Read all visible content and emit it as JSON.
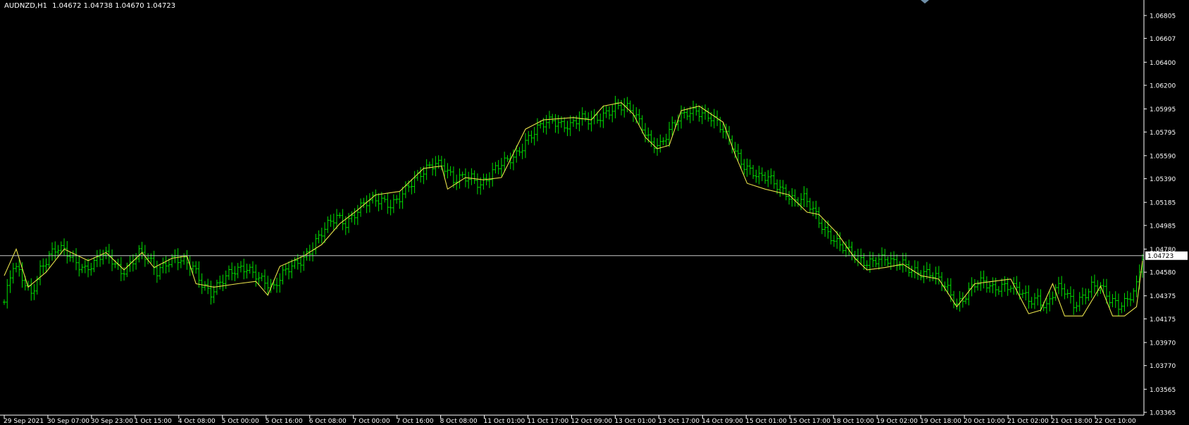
{
  "window": {
    "symbol_timeframe": "AUDNZD,H1",
    "ohlc": "1.04672 1.04738 1.04670 1.04723"
  },
  "colors": {
    "background": "#000000",
    "bars": "#00e000",
    "moving_average": "#e6e04a",
    "price_line": "#c8c8c8",
    "axis": "#ffffff",
    "label_bg": "#ffffff",
    "label_text": "#000000"
  },
  "chart_data": {
    "type": "bar",
    "current_price": "1.04723",
    "y_ticks": [
      "1.06805",
      "1.06607",
      "1.06400",
      "1.06200",
      "1.05995",
      "1.05795",
      "1.05590",
      "1.05390",
      "1.05185",
      "1.04985",
      "1.04780",
      "1.04580",
      "1.04375",
      "1.04175",
      "1.03970",
      "1.03770",
      "1.03565",
      "1.03365"
    ],
    "ylim": [
      1.03365,
      1.06805
    ],
    "x_ticks": [
      "29 Sep 2021",
      "30 Sep 07:00",
      "30 Sep 23:00",
      "1 Oct 15:00",
      "4 Oct 08:00",
      "5 Oct 00:00",
      "5 Oct 16:00",
      "6 Oct 08:00",
      "7 Oct 00:00",
      "7 Oct 16:00",
      "8 Oct 08:00",
      "11 Oct 01:00",
      "11 Oct 17:00",
      "12 Oct 09:00",
      "13 Oct 01:00",
      "13 Oct 17:00",
      "14 Oct 09:00",
      "15 Oct 01:00",
      "15 Oct 17:00",
      "18 Oct 10:00",
      "19 Oct 02:00",
      "19 Oct 18:00",
      "20 Oct 10:00",
      "21 Oct 02:00",
      "21 Oct 18:00",
      "22 Oct 10:00"
    ],
    "price_path": [
      [
        0,
        1.0432
      ],
      [
        3,
        1.0462
      ],
      [
        6,
        1.0452
      ],
      [
        9,
        1.044
      ],
      [
        12,
        1.0462
      ],
      [
        15,
        1.0472
      ],
      [
        18,
        1.0477
      ],
      [
        21,
        1.0474
      ],
      [
        24,
        1.0468
      ],
      [
        27,
        1.0462
      ],
      [
        30,
        1.0465
      ],
      [
        33,
        1.0472
      ],
      [
        36,
        1.0468
      ],
      [
        39,
        1.046
      ],
      [
        42,
        1.0466
      ],
      [
        45,
        1.0474
      ],
      [
        48,
        1.0468
      ],
      [
        51,
        1.0458
      ],
      [
        54,
        1.0468
      ],
      [
        57,
        1.0472
      ],
      [
        60,
        1.0466
      ],
      [
        63,
        1.046
      ],
      [
        66,
        1.0448
      ],
      [
        69,
        1.0442
      ],
      [
        72,
        1.045
      ],
      [
        75,
        1.0455
      ],
      [
        78,
        1.0458
      ],
      [
        81,
        1.0462
      ],
      [
        84,
        1.0458
      ],
      [
        87,
        1.045
      ],
      [
        90,
        1.0442
      ],
      [
        93,
        1.0455
      ],
      [
        96,
        1.0465
      ],
      [
        99,
        1.047
      ],
      [
        102,
        1.0476
      ],
      [
        105,
        1.0486
      ],
      [
        108,
        1.0498
      ],
      [
        111,
        1.0508
      ],
      [
        114,
        1.0502
      ],
      [
        117,
        1.0508
      ],
      [
        120,
        1.0515
      ],
      [
        123,
        1.052
      ],
      [
        126,
        1.0522
      ],
      [
        129,
        1.0518
      ],
      [
        132,
        1.0522
      ],
      [
        135,
        1.053
      ],
      [
        138,
        1.054
      ],
      [
        141,
        1.055
      ],
      [
        144,
        1.0555
      ],
      [
        147,
        1.0548
      ],
      [
        150,
        1.0535
      ],
      [
        153,
        1.054
      ],
      [
        156,
        1.0542
      ],
      [
        159,
        1.0535
      ],
      [
        162,
        1.054
      ],
      [
        165,
        1.0548
      ],
      [
        168,
        1.0555
      ],
      [
        171,
        1.0562
      ],
      [
        174,
        1.0572
      ],
      [
        177,
        1.0578
      ],
      [
        180,
        1.0585
      ],
      [
        183,
        1.059
      ],
      [
        186,
        1.0588
      ],
      [
        189,
        1.0586
      ],
      [
        192,
        1.059
      ],
      [
        195,
        1.0588
      ],
      [
        198,
        1.0592
      ],
      [
        201,
        1.0598
      ],
      [
        204,
        1.0602
      ],
      [
        207,
        1.06
      ],
      [
        210,
        1.0595
      ],
      [
        213,
        1.0585
      ],
      [
        216,
        1.0572
      ],
      [
        219,
        1.0568
      ],
      [
        222,
        1.0578
      ],
      [
        225,
        1.059
      ],
      [
        228,
        1.0598
      ],
      [
        231,
        1.06
      ],
      [
        234,
        1.0594
      ],
      [
        237,
        1.0588
      ],
      [
        240,
        1.058
      ],
      [
        243,
        1.057
      ],
      [
        246,
        1.0555
      ],
      [
        249,
        1.0545
      ],
      [
        252,
        1.0538
      ],
      [
        255,
        1.054
      ],
      [
        258,
        1.0535
      ],
      [
        261,
        1.0528
      ],
      [
        264,
        1.0518
      ],
      [
        267,
        1.052
      ],
      [
        270,
        1.0512
      ],
      [
        273,
        1.05
      ],
      [
        276,
        1.049
      ],
      [
        279,
        1.048
      ],
      [
        282,
        1.0474
      ],
      [
        285,
        1.047
      ],
      [
        288,
        1.0468
      ],
      [
        291,
        1.047
      ],
      [
        294,
        1.0468
      ],
      [
        297,
        1.0464
      ],
      [
        300,
        1.0466
      ],
      [
        303,
        1.0462
      ],
      [
        306,
        1.0458
      ],
      [
        309,
        1.0455
      ],
      [
        312,
        1.045
      ],
      [
        315,
        1.0444
      ],
      [
        318,
        1.0432
      ],
      [
        321,
        1.0438
      ],
      [
        324,
        1.0446
      ],
      [
        327,
        1.0448
      ],
      [
        330,
        1.0445
      ],
      [
        333,
        1.0448
      ],
      [
        336,
        1.0446
      ],
      [
        339,
        1.044
      ],
      [
        342,
        1.0432
      ],
      [
        345,
        1.0436
      ],
      [
        348,
        1.043
      ],
      [
        351,
        1.0445
      ],
      [
        354,
        1.044
      ],
      [
        357,
        1.0428
      ],
      [
        360,
        1.0438
      ],
      [
        363,
        1.0448
      ],
      [
        366,
        1.0445
      ],
      [
        369,
        1.0432
      ],
      [
        372,
        1.0428
      ],
      [
        375,
        1.0436
      ],
      [
        378,
        1.0448
      ],
      [
        380,
        1.0472
      ]
    ],
    "ma_path": [
      [
        0,
        1.0455
      ],
      [
        4,
        1.0478
      ],
      [
        8,
        1.0445
      ],
      [
        14,
        1.0458
      ],
      [
        20,
        1.0478
      ],
      [
        28,
        1.0468
      ],
      [
        34,
        1.0475
      ],
      [
        40,
        1.046
      ],
      [
        46,
        1.0475
      ],
      [
        50,
        1.0462
      ],
      [
        56,
        1.047
      ],
      [
        61,
        1.0472
      ],
      [
        64,
        1.0448
      ],
      [
        70,
        1.0445
      ],
      [
        78,
        1.0448
      ],
      [
        84,
        1.045
      ],
      [
        88,
        1.0438
      ],
      [
        92,
        1.0463
      ],
      [
        100,
        1.0472
      ],
      [
        106,
        1.0482
      ],
      [
        112,
        1.05
      ],
      [
        118,
        1.0512
      ],
      [
        124,
        1.0525
      ],
      [
        132,
        1.0528
      ],
      [
        140,
        1.0548
      ],
      [
        146,
        1.055
      ],
      [
        148,
        1.053
      ],
      [
        154,
        1.054
      ],
      [
        160,
        1.0538
      ],
      [
        166,
        1.054
      ],
      [
        174,
        1.0582
      ],
      [
        180,
        1.059
      ],
      [
        190,
        1.0592
      ],
      [
        196,
        1.059
      ],
      [
        200,
        1.0602
      ],
      [
        206,
        1.0605
      ],
      [
        210,
        1.0595
      ],
      [
        214,
        1.0575
      ],
      [
        218,
        1.0565
      ],
      [
        222,
        1.0568
      ],
      [
        226,
        1.0598
      ],
      [
        232,
        1.0602
      ],
      [
        240,
        1.0588
      ],
      [
        244,
        1.056
      ],
      [
        248,
        1.0535
      ],
      [
        254,
        1.053
      ],
      [
        262,
        1.0525
      ],
      [
        268,
        1.051
      ],
      [
        272,
        1.0508
      ],
      [
        278,
        1.0492
      ],
      [
        284,
        1.047
      ],
      [
        288,
        1.046
      ],
      [
        294,
        1.0462
      ],
      [
        300,
        1.0465
      ],
      [
        306,
        1.0455
      ],
      [
        312,
        1.0452
      ],
      [
        318,
        1.0428
      ],
      [
        324,
        1.0448
      ],
      [
        330,
        1.045
      ],
      [
        336,
        1.0452
      ],
      [
        342,
        1.0422
      ],
      [
        346,
        1.0425
      ],
      [
        350,
        1.0448
      ],
      [
        354,
        1.042
      ],
      [
        360,
        1.042
      ],
      [
        366,
        1.0446
      ],
      [
        370,
        1.042
      ],
      [
        374,
        1.042
      ],
      [
        378,
        1.0428
      ],
      [
        380,
        1.0468
      ]
    ]
  }
}
